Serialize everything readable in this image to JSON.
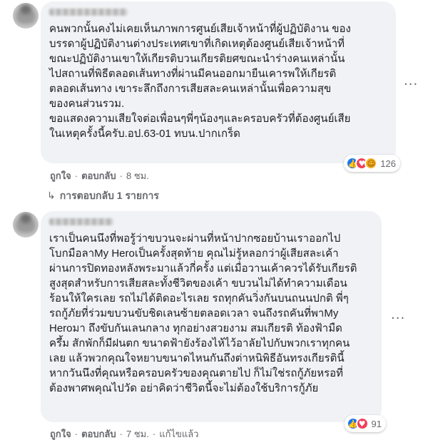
{
  "comment1": {
    "text": "คนพวกนั้นคงไม่เคยเห็นภาพการศูนย์เสียเจ้าหน้าที่ผู้ปฏิบัติงาน ของ\nบรรดาผู้ปฏิบัติงานต่างประเทศเขาที่เกิดเหตุต้องศูนย์เสียเจ้าหน้าที่\nขณะปฏิบัติงานเขาให้เกียรติบวนเกียรติยศขณะนำร่างคนเหล่านั้น\nไปสถานที่พิธีตลอดเส้นทางที่ผ่านมีคนออกมายืนเคารพให้เกียรติ\nตลอดเส้นทาง เขาระลึกถึงการเสียสละคนเหล่านั้นเพื่อความสุข\nของคนส่วนรวม.\nขอแสดงความเสียใจต่อเพื่อนๆพี่ๆน้องๆและครอบครัวที่ต้องศูนย์เสีย\nในเหตุครั้งนี้ครับ.อป.63-01 ทบน.ปากเกร็ด",
    "reaction_count": "126",
    "like_label": "ถูกใจ",
    "reply_label": "ตอบกลับ",
    "time": "8 ชม.",
    "replies_label": "การตอบกลับ 1 รายการ",
    "more": "···"
  },
  "comment2": {
    "text": "เราเป็นคนนึงที่พอรู้ว่าขบวนจะผ่านที่หน้าปากซอยบ้านเราออกไป\nโบกมือลาMy Heroเป็นครั้งสุดท้าย คุณไม่รู้หลอกว่าผู้เสียสละเค้า\nผ่านการปิดทองหลังพระมาแล้วกี่ครั้ง แต่เมื่อวานเค้าควรได้รับเกียรติ\nสูงสุดสำหรับการเสียสละทั้งชีวิตของเค้า ขบวนไม่ได้ทำความเดือน\nร้อนให้ใครเลย รถไม่ได้ติดอะไรเลย รถทุกคันวิ่งกันบนถนนปกติ พี่ๆ\nรถกู้ภัยที่ร่วมขบวนขับชิดเลนซ้ายตลอดเวลา จนถึงรถคันที่พาMy\nHeroมา ถึงขับกันเลนกลาง ทุกอย่างสวยงาม สมเกียรติ ท้องฟ้ามืด\nครึ้ม สักพักก็มีฝนตก ขนาดฟ้ายังร้องไห้ไว้อาลัยไปกับพวกเราทุกคน\nเลย แล้วพวกคุณใจหยาบขนาดไหนกันถึงต่าหนิพิธีอันทรงเกียรตินี้\nหากวันนึงที่คุณหรือครอบครัวของคุณตายไป ก็ไม่ใช่รถกู้ภัยหรอที่\nต้องพาศพคุณไปวัด อย่าคิดว่าชีวิตนี้จะไม่ต้องใช้บริการกู้ภัย",
    "reaction_count": "91",
    "like_label": "ถูกใจ",
    "reply_label": "ตอบกลับ",
    "time": "7 ชม.",
    "edited_label": "แก้ไขแล้ว",
    "more": "···"
  },
  "colors": {
    "bubble": "#f0f2f5",
    "meta": "#65676b",
    "like": "#1877f2",
    "love": "#f33e58",
    "care": "#f7b125"
  },
  "icons": [
    "like-icon",
    "love-icon",
    "care-icon",
    "reply-arrow-icon",
    "more-options-icon"
  ]
}
